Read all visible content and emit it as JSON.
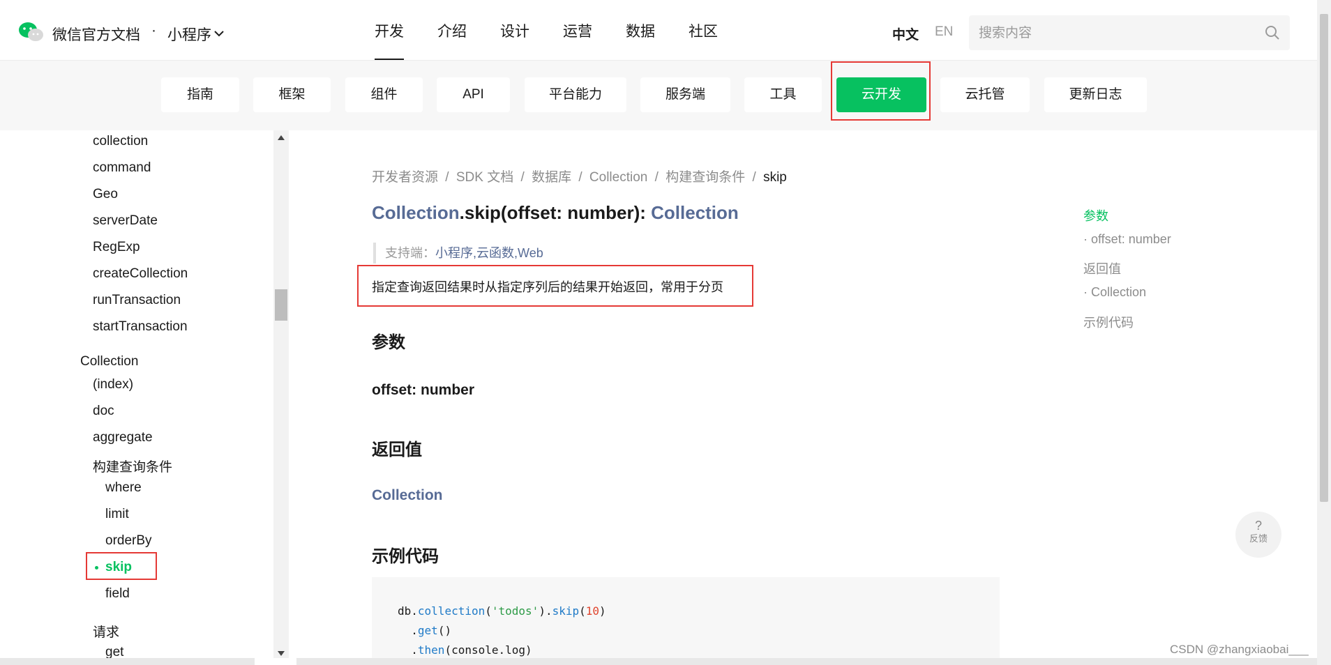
{
  "header": {
    "brand": "微信官方文档",
    "brand_separator": "·",
    "product": "小程序",
    "nav": [
      "开发",
      "介绍",
      "设计",
      "运营",
      "数据",
      "社区"
    ],
    "active_nav": "开发",
    "lang_zh": "中文",
    "lang_en": "EN",
    "search_placeholder": "搜索内容"
  },
  "subnav": {
    "tabs": [
      "指南",
      "框架",
      "组件",
      "API",
      "平台能力",
      "服务端",
      "工具",
      "云开发",
      "云托管",
      "更新日志"
    ],
    "active_tab": "云开发"
  },
  "sidebar": {
    "items": [
      "collection",
      "command",
      "Geo",
      "serverDate",
      "RegExp",
      "createCollection",
      "runTransaction",
      "startTransaction",
      "Collection",
      "(index)",
      "doc",
      "aggregate",
      "构建查询条件",
      "where",
      "limit",
      "orderBy",
      "skip",
      "field",
      "请求",
      "get"
    ],
    "active_item": "skip"
  },
  "content": {
    "breadcrumb": [
      "开发者资源",
      "SDK 文档",
      "数据库",
      "Collection",
      "构建查询条件",
      "skip"
    ],
    "breadcrumb_sep": "/",
    "title_class": "Collection",
    "title_method": ".skip(offset: number): ",
    "title_return": "Collection",
    "support_label": "支持端：",
    "support_platforms": [
      "小程序",
      "云函数",
      "Web"
    ],
    "support_sep": ",",
    "description": "指定查询返回结果时从指定序列后的结果开始返回，常用于分页",
    "params_heading": "参数",
    "param_name": "offset: number",
    "return_heading": "返回值",
    "return_type": "Collection",
    "example_heading": "示例代码",
    "code": {
      "l1_obj": "db.",
      "l1_fn1": "collection",
      "l1_p1": "(",
      "l1_str": "'todos'",
      "l1_p2": ").",
      "l1_fn2": "skip",
      "l1_p3": "(",
      "l1_num": "10",
      "l1_p4": ")",
      "l2_dot": "  .",
      "l2_fn": "get",
      "l2_rest": "()",
      "l3_dot": "  .",
      "l3_fn": "then",
      "l3_rest": "(console.log)"
    }
  },
  "toc": [
    "参数",
    "· offset: number",
    "返回值",
    "· Collection",
    "示例代码"
  ],
  "toc_active": "参数",
  "feedback": {
    "symbol": "?",
    "label": "反馈"
  },
  "watermark": "CSDN @zhangxiaobai___",
  "colors": {
    "accent": "#07c160",
    "link": "#576b95",
    "highlight": "#e53935"
  }
}
